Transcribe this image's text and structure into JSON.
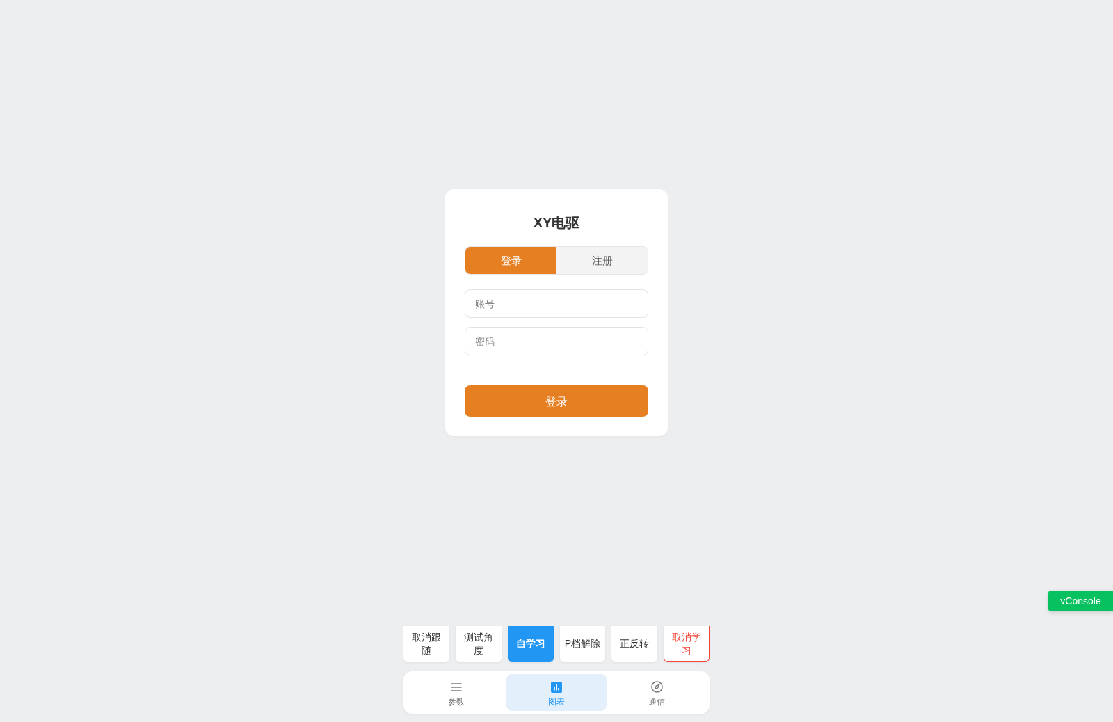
{
  "app_title": "XY电驱",
  "auth_tabs": [
    {
      "label": "登录",
      "selected": true
    },
    {
      "label": "注册",
      "selected": false
    }
  ],
  "fields": [
    {
      "placeholder": "账号"
    },
    {
      "placeholder": "密码"
    }
  ],
  "submit_button": "登录",
  "action_buttons": [
    {
      "label": "取消跟随",
      "kind": "normal",
      "selected": false
    },
    {
      "label": "测试角度",
      "kind": "normal",
      "selected": false
    },
    {
      "label": "自学习",
      "kind": "normal",
      "selected": true
    },
    {
      "label": "P档解除",
      "kind": "normal",
      "selected": false
    },
    {
      "label": "正反转",
      "kind": "normal",
      "selected": false
    },
    {
      "label": "取消学习",
      "kind": "danger",
      "selected": false
    }
  ],
  "bottom_nav": [
    {
      "label": "参数",
      "selected": false
    },
    {
      "label": "图表",
      "selected": true
    },
    {
      "label": "通信",
      "selected": false
    }
  ],
  "vconsole_button": "vConsole"
}
